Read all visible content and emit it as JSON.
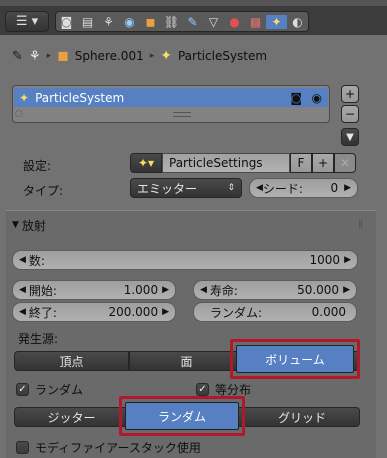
{
  "toolbar": {
    "icons": [
      "editor-type-icon",
      "render-icon",
      "render-layers-icon",
      "scene-icon",
      "world-icon",
      "object-icon",
      "constraints-icon",
      "modifiers-icon",
      "data-icon",
      "material-icon",
      "texture-icon",
      "particles-icon",
      "physics-icon"
    ]
  },
  "breadcrumb": {
    "object": "Sphere.001",
    "particle_system": "ParticleSystem"
  },
  "particle_list": {
    "items": [
      {
        "label": "ParticleSystem"
      }
    ]
  },
  "settings": {
    "label": "設定:",
    "value": "ParticleSettings",
    "fake_user": "F"
  },
  "type": {
    "label": "タイプ:",
    "value": "エミッター",
    "seed_label": "シード:",
    "seed_value": "0"
  },
  "emission": {
    "title": "放射",
    "number_label": "数:",
    "number_value": "1000",
    "start_label": "開始:",
    "start_value": "1.000",
    "lifetime_label": "寿命:",
    "lifetime_value": "50.000",
    "end_label": "終了:",
    "end_value": "200.000",
    "random_label": "ランダム:",
    "random_value": "0.000",
    "emit_from_label": "発生源:",
    "emit_from": [
      "頂点",
      "面",
      "ボリューム"
    ],
    "random_check": "ランダム",
    "even_check": "等分布",
    "distribution": [
      "ジッター",
      "ランダム",
      "グリッド"
    ],
    "modifier_stack": "モディファイアースタック使用"
  },
  "colors": {
    "panel_bg": "#727272",
    "selected_blue": "#5680c2",
    "highlight_red": "#b0182c"
  }
}
